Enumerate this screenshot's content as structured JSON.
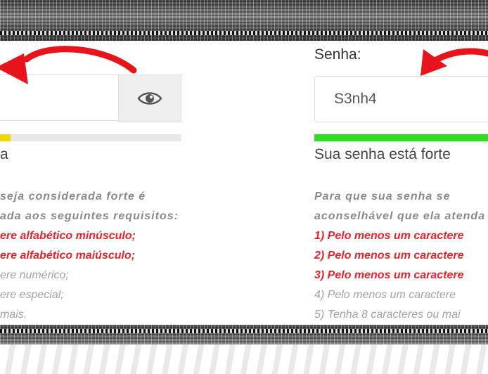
{
  "left_panel": {
    "strength": 0.06,
    "strength_color": "#f2d600",
    "strength_text": "a",
    "toggle_icon": "eye-icon",
    "requirements": [
      {
        "text": "seja considerada forte é",
        "status": "intro"
      },
      {
        "text": "ada aos seguintes requisitos:",
        "status": "intro"
      },
      {
        "text": "ere alfabético minúsculo;",
        "status": "fail"
      },
      {
        "text": "ere alfabético maiúsculo;",
        "status": "fail"
      },
      {
        "text": "ere numérico;",
        "status": "ok"
      },
      {
        "text": "ere especial;",
        "status": "ok"
      },
      {
        "text": "mais.",
        "status": "ok"
      }
    ]
  },
  "right_panel": {
    "label": "Senha:",
    "password_value": "S3nh4",
    "strength": 1.0,
    "strength_color": "#2ddf1c",
    "strength_text": "Sua senha está forte",
    "requirements": [
      {
        "text": "Para que sua senha se",
        "status": "intro"
      },
      {
        "text": "aconselhável que ela atenda",
        "status": "intro"
      },
      {
        "text": "1) Pelo menos um caractere",
        "status": "fail"
      },
      {
        "text": "2) Pelo menos um caractere",
        "status": "fail"
      },
      {
        "text": "3) Pelo menos um caractere",
        "status": "fail"
      },
      {
        "text": "4) Pelo menos um caractere",
        "status": "ok"
      },
      {
        "text": "5) Tenha 8 caracteres ou mai",
        "status": "ok"
      }
    ]
  },
  "colors": {
    "requirement_fail": "#e8232a",
    "requirement_ok": "#a2a2a2",
    "arrow": "#e8141c"
  }
}
